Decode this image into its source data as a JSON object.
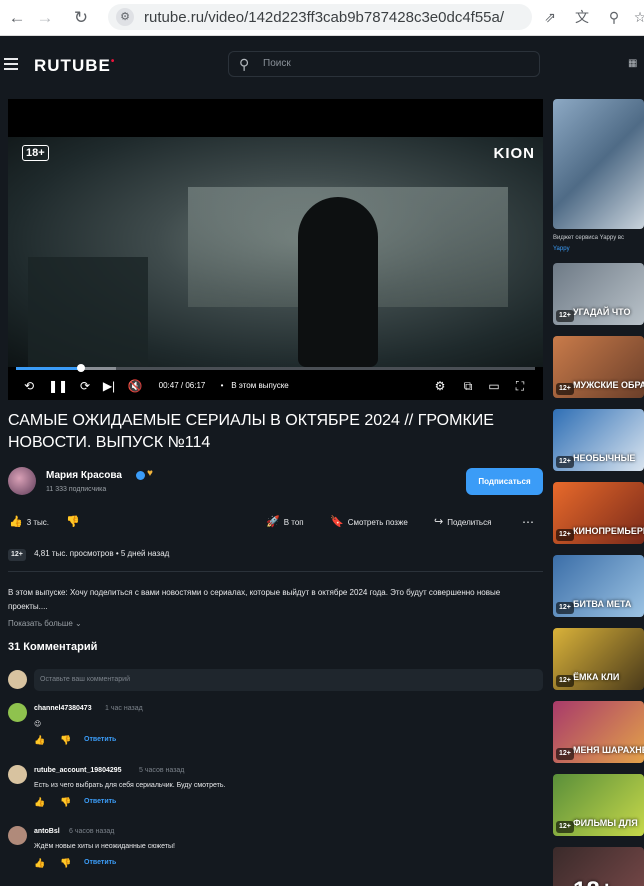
{
  "browser": {
    "url": "rutube.ru/video/142d223ff3cab9b787428c3e0dc4f55a/"
  },
  "header": {
    "logo": "RUTUBE",
    "search_placeholder": "Поиск"
  },
  "player": {
    "age_badge": "18+",
    "brand": "KION",
    "time": "00:47 / 06:17",
    "chapter": "В этом выпуске",
    "progress": 0.125
  },
  "video": {
    "title": "САМЫЕ ОЖИДАЕМЫЕ СЕРИАЛЫ В ОКТЯБРЕ 2024 // ГРОМКИЕ НОВОСТИ. ВЫПУСК №114",
    "channel_name": "Мария Красова",
    "subscribers": "11 333 подписчика",
    "subscribe_label": "Подписаться",
    "likes": "3 тыс.",
    "actions": {
      "top": "В топ",
      "watch_later": "Смотреть позже",
      "share": "Поделиться"
    },
    "age": "12+",
    "views": "4,81 тыс. просмотров",
    "published": "5 дней назад",
    "description": "В этом выпуске: Хочу поделиться с вами новостями о сериалах, которые выйдут в октябре 2024 года. Это будут совершенно новые проекты....",
    "show_more": "Показать больше"
  },
  "comments": {
    "count_label": "31 Комментарий",
    "placeholder": "Оставьте ваш комментарий",
    "reply_label": "Ответить",
    "items": [
      {
        "user": "channel47380473",
        "time": "1 час назад",
        "text": "😉"
      },
      {
        "user": "rutube_account_19804295",
        "time": "5 часов назад",
        "text": "Есть из чего выбрать для себя сериальчик. Буду смотреть."
      },
      {
        "user": "antoBsl",
        "time": "6 часов назад",
        "text": "Ждём новые хиты и неожиданные сюжеты!"
      }
    ]
  },
  "sidebar": {
    "first_title": "Виджет сервиса Yappy вс",
    "first_channel": "Yappy",
    "cards": [
      {
        "age": "12+",
        "caption": "УГАДАЙ ЧТО"
      },
      {
        "age": "12+",
        "caption": "МУЖСКИЕ ОБРАЗЫ"
      },
      {
        "age": "12+",
        "caption": "НЕОБЫЧНЫЕ"
      },
      {
        "age": "12+",
        "caption": "КИНОПРЕМЬЕРЫ ОКТЯБРЕ"
      },
      {
        "age": "12+",
        "caption": "БИТВА МЕТА"
      },
      {
        "age": "12+",
        "caption": "ЁМКА КЛИ"
      },
      {
        "age": "12+",
        "caption": "МЕНЯ ШАРАХНЕТ"
      },
      {
        "age": "12+",
        "caption": "ФИЛЬМЫ ДЛЯ"
      },
      {
        "age": "18+",
        "caption": ""
      }
    ]
  },
  "colors": {
    "background": "#14191f",
    "accent": "#3b9cf7",
    "brand": "#ed143b"
  }
}
